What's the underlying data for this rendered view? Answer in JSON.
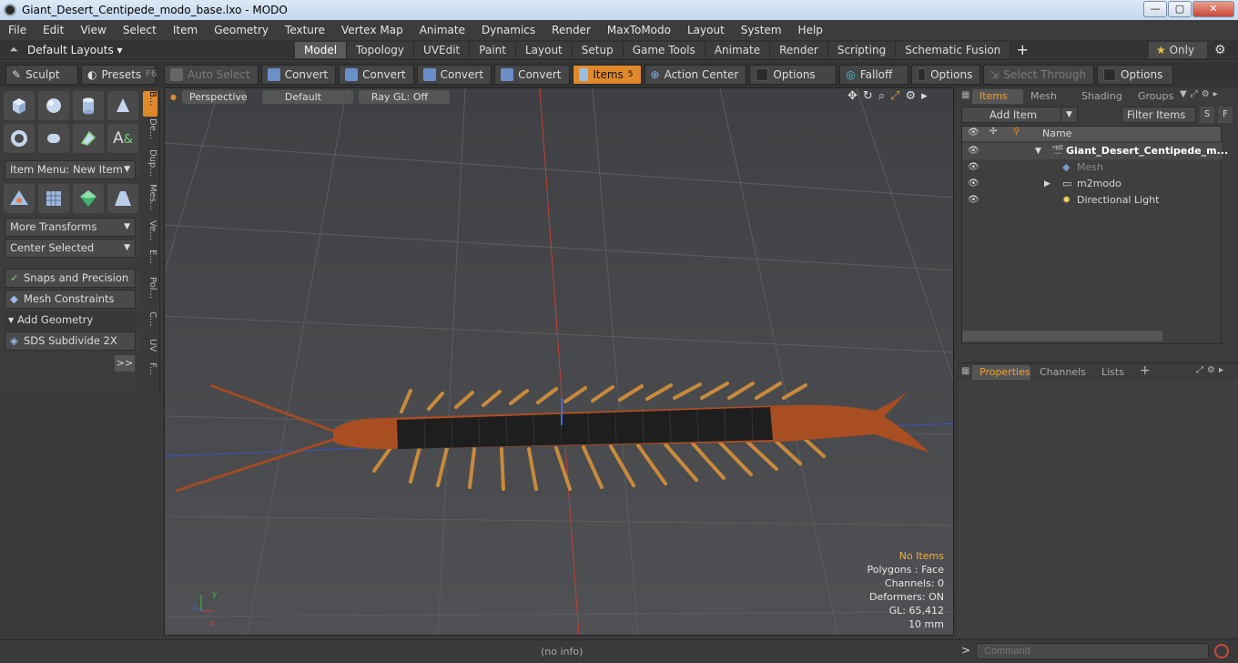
{
  "window": {
    "title": "Giant_Desert_Centipede_modo_base.lxo - MODO",
    "min": "—",
    "max": "▢",
    "close": "✕"
  },
  "menu": [
    "File",
    "Edit",
    "View",
    "Select",
    "Item",
    "Geometry",
    "Texture",
    "Vertex Map",
    "Animate",
    "Dynamics",
    "Render",
    "MaxToModo",
    "Layout",
    "System",
    "Help"
  ],
  "layouts": {
    "default_label": "Default Layouts",
    "tabs": [
      "Model",
      "Topology",
      "UVEdit",
      "Paint",
      "Layout",
      "Setup",
      "Game Tools",
      "Animate",
      "Render",
      "Scripting",
      "Schematic Fusion"
    ],
    "active": "Model",
    "add": "+",
    "only": "Only"
  },
  "toolbar": {
    "sculpt": "Sculpt",
    "presets": "Presets",
    "presets_key": "F6",
    "auto_select": "Auto Select",
    "convert": "Convert",
    "items": "Items",
    "items_key": "5",
    "action_center": "Action Center",
    "options": "Options",
    "falloff": "Falloff",
    "select_through": "Select Through"
  },
  "left": {
    "item_menu": "Item Menu: New Item",
    "more_transforms": "More Transforms",
    "center_selected": "Center Selected",
    "snaps": "Snaps and Precision",
    "mesh_constraints": "Mesh Constraints",
    "add_geometry": "Add Geometry",
    "sds": "SDS Subdivide 2X",
    "more": ">>"
  },
  "vtabs": [
    "B...",
    "De...",
    "Dup...",
    "Mes...",
    "Ve...",
    "E...",
    "Pol...",
    "C...",
    "UV",
    "F..."
  ],
  "viewport": {
    "view": "Perspective",
    "shading": "Default",
    "raygl": "Ray GL: Off",
    "hud": {
      "items": "No Items",
      "polygons": "Polygons : Face",
      "channels": "Channels: 0",
      "deformers": "Deformers: ON",
      "gl": "GL: 65,412",
      "scale": "10 mm"
    }
  },
  "items_panel": {
    "tabs": [
      "Items",
      "Mesh ...",
      "Shading",
      "Groups"
    ],
    "add_item": "Add Item",
    "filter": "Filter Items",
    "s": "S",
    "f": "F",
    "name_col": "Name",
    "rows": [
      "Giant_Desert_Centipede_m...",
      "Mesh",
      "m2modo",
      "Directional Light"
    ]
  },
  "props_panel": {
    "tabs": [
      "Properties",
      "Channels",
      "Lists"
    ],
    "add": "+"
  },
  "status": {
    "info": "(no info)",
    "prompt": ">",
    "command_placeholder": "Command"
  }
}
